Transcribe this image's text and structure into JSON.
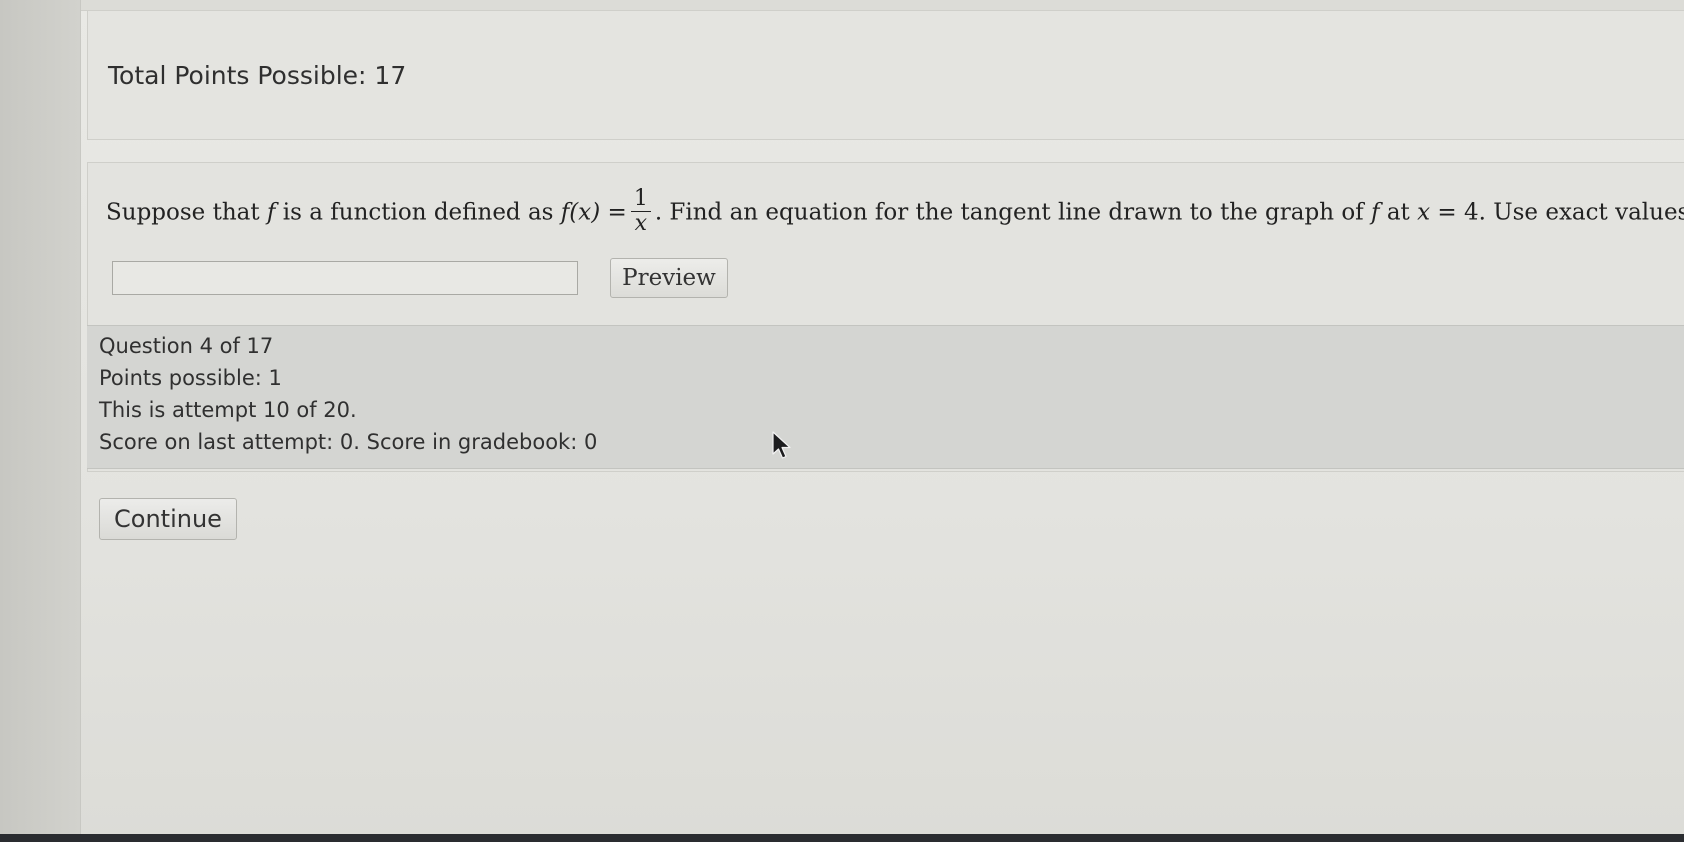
{
  "header": {
    "total_points_label": "Total Points Possible: 17"
  },
  "question": {
    "text_part1": "Suppose that ",
    "var_f": "f",
    "text_part2": " is a function defined as ",
    "func_expr": "f(x) =",
    "frac_numerator": "1",
    "frac_denominator": "x",
    "text_part3": ". Find an equation for the tangent line drawn to the graph of ",
    "var_f2": "f",
    "text_part4": " at ",
    "x_expr": "x",
    "x_value": " = 4",
    "text_part5": ". Use exact values.",
    "answer_value": "",
    "preview_label": "Preview"
  },
  "info": {
    "question_number": "Question 4 of 17",
    "points_possible": "Points possible: 1",
    "attempt": "This is attempt 10 of 20.",
    "score": "Score on last attempt: 0. Score in gradebook: 0"
  },
  "actions": {
    "continue_label": "Continue"
  }
}
